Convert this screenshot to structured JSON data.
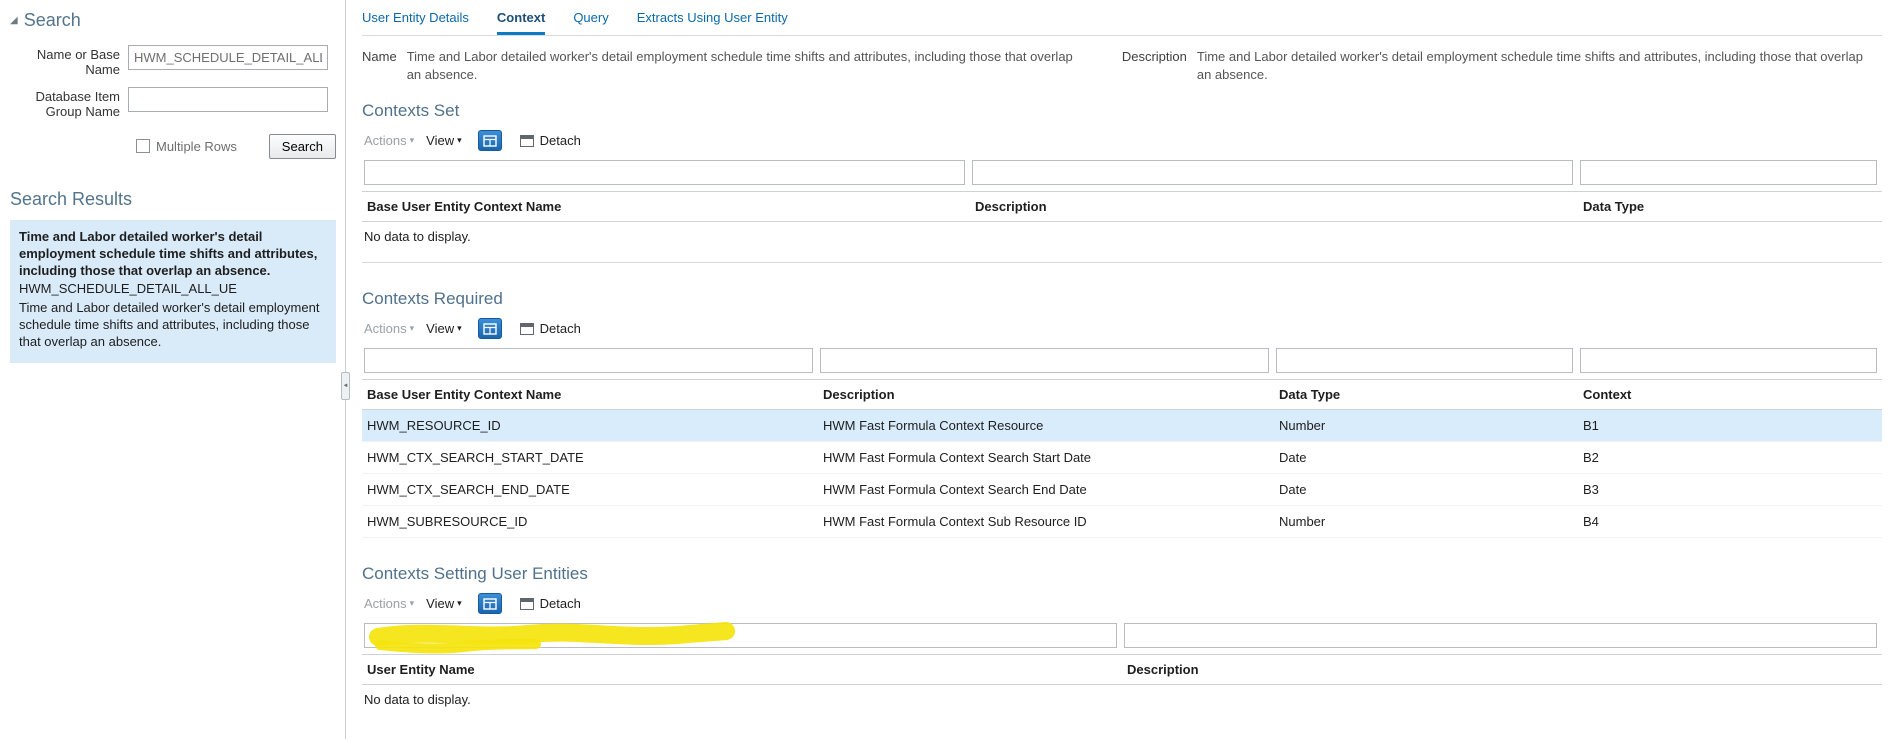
{
  "colors": {
    "selected_row": "#d9ecfb",
    "highlighter_yellow": "#f4e40c",
    "accent_blue": "#1a66ad"
  },
  "icons": {
    "disclosure_expanded": "◢",
    "dropdown_arrow": "▾",
    "splitter_arrow": "◄"
  },
  "search_panel": {
    "title": "Search",
    "fields": [
      {
        "label": "Name or Base Name",
        "value": "HWM_SCHEDULE_DETAIL_ALL_UE"
      },
      {
        "label": "Database Item Group Name",
        "value": ""
      }
    ],
    "multiple_rows_label": "Multiple Rows",
    "search_button": "Search",
    "results_title": "Search Results",
    "result": {
      "title": "Time and Labor detailed worker's detail employment schedule time shifts and attributes, including those that overlap an absence.",
      "code": "HWM_SCHEDULE_DETAIL_ALL_UE",
      "description": "Time and Labor detailed worker's detail employment schedule time shifts and attributes, including those that overlap an absence."
    }
  },
  "tabs": [
    {
      "label": "User Entity Details"
    },
    {
      "label": "Context"
    },
    {
      "label": "Query"
    },
    {
      "label": "Extracts Using User Entity"
    }
  ],
  "detail_header": {
    "name_label": "Name",
    "name_value": "Time and Labor detailed worker's detail employment schedule time shifts and attributes, including those that overlap an absence.",
    "description_label": "Description",
    "description_value": "Time and Labor detailed worker's detail employment schedule time shifts and attributes, including those that overlap an absence."
  },
  "toolbar": {
    "actions_label": "Actions",
    "view_label": "View",
    "detach_label": "Detach"
  },
  "sections": [
    {
      "title": "Contexts Set",
      "columns": [
        "Base User Entity Context Name",
        "Description",
        "Data Type"
      ],
      "rows": [],
      "empty_text": "No data to display."
    },
    {
      "title": "Contexts Required",
      "columns": [
        "Base User Entity Context Name",
        "Description",
        "Data Type",
        "Context"
      ],
      "selected_row_index": 0,
      "rows": [
        [
          "HWM_RESOURCE_ID",
          "HWM Fast Formula Context Resource",
          "Number",
          "B1"
        ],
        [
          "HWM_CTX_SEARCH_START_DATE",
          "HWM Fast Formula Context Search Start Date",
          "Date",
          "B2"
        ],
        [
          "HWM_CTX_SEARCH_END_DATE",
          "HWM Fast Formula Context Search End Date",
          "Date",
          "B3"
        ],
        [
          "HWM_SUBRESOURCE_ID",
          "HWM Fast Formula Context Sub Resource ID",
          "Number",
          "B4"
        ]
      ]
    },
    {
      "title": "Contexts Setting User Entities",
      "columns": [
        "User Entity Name",
        "Description"
      ],
      "rows": [],
      "empty_text": "No data to display."
    }
  ]
}
